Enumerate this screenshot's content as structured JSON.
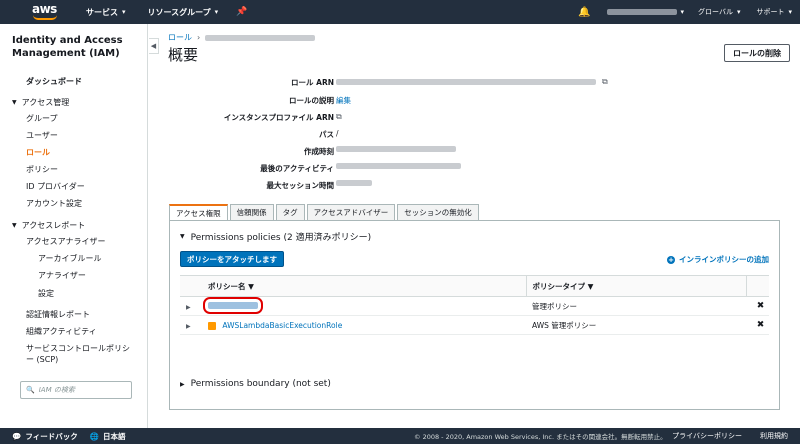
{
  "topbar": {
    "logo": "aws",
    "services": "サービス",
    "resource_groups": "リソースグループ",
    "region": "グローバル",
    "support": "サポート"
  },
  "sidebar": {
    "title": "Identity and Access Management (IAM)",
    "dashboard": "ダッシュボード",
    "access_mgmt": "アクセス管理",
    "items": [
      "グループ",
      "ユーザー",
      "ロール",
      "ポリシー",
      "ID プロバイダー",
      "アカウント設定"
    ],
    "access_reports": "アクセスレポート",
    "analyzer": "アクセスアナライザー",
    "analyzer_items": [
      "アーカイブルール",
      "アナライザー",
      "設定"
    ],
    "other_items": [
      "認証情報レポート",
      "組織アクティビティ",
      "サービスコントロールポリシー (SCP)"
    ],
    "search_placeholder": "IAM の検索"
  },
  "main": {
    "breadcrumb_root": "ロール",
    "title": "概要",
    "delete_button": "ロールの削除",
    "fields": {
      "arn": "ロール ARN",
      "description": "ロールの説明",
      "description_value": "編集",
      "instance_profile": "インスタンスプロファイル ARN",
      "path": "パス",
      "path_value": "/",
      "created": "作成時刻",
      "last_activity": "最後のアクティビティ",
      "max_session": "最大セッション時間"
    },
    "tabs": [
      "アクセス権限",
      "信頼関係",
      "タグ",
      "アクセスアドバイザー",
      "セッションの無効化"
    ],
    "permissions_header": "Permissions policies (2 適用済みポリシー)",
    "attach_button": "ポリシーをアタッチします",
    "inline_policy_link": "インラインポリシーの追加",
    "table": {
      "col_name": "ポリシー名",
      "col_type": "ポリシータイプ",
      "rows": [
        {
          "name": "",
          "type": "管理ポリシー"
        },
        {
          "name": "AWSLambdaBasicExecutionRole",
          "type": "AWS 管理ポリシー"
        }
      ]
    },
    "boundary_header": "Permissions boundary (not set)"
  },
  "footer": {
    "feedback": "フィードバック",
    "language": "日本語",
    "copyright": "© 2008 - 2020, Amazon Web Services, Inc. またはその関連会社。無断転用禁止。",
    "privacy": "プライバシーポリシー",
    "terms": "利用規約"
  },
  "colors": {
    "nav_bg": "#232f3e",
    "accent": "#ec7211",
    "link": "#0073bb",
    "highlight": "#e00000"
  }
}
